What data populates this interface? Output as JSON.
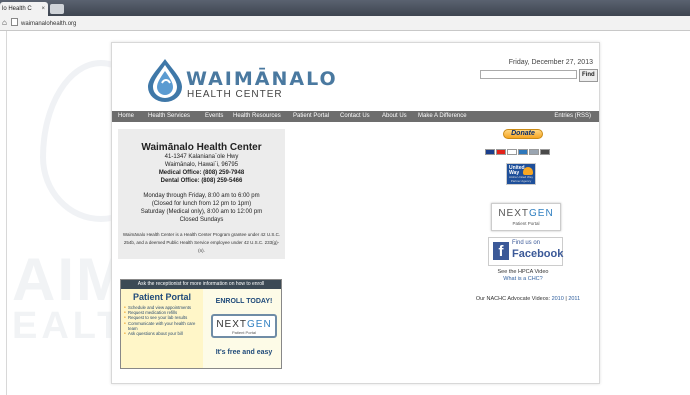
{
  "browser": {
    "tab_title": "lo Health C",
    "tab_close": "×",
    "url": "waimanalohealth.org"
  },
  "watermark": {
    "word1": "AIM",
    "word2": "EALTH"
  },
  "header": {
    "logo_name": "WAIMĀNALO",
    "logo_sub": "HEALTH CENTER",
    "date": "Friday, December 27, 2013",
    "search_placeholder": "",
    "find_label": "Find"
  },
  "nav": {
    "items": [
      "Home",
      "Health Services",
      "Events",
      "Health Resources",
      "Patient Portal",
      "Contact Us",
      "About Us",
      "Make A Difference"
    ],
    "rss": "Entries (RSS)"
  },
  "contact": {
    "title": "Waimānalo Health Center",
    "address1": "41-1347 Kalaniana`ole Hwy",
    "address2": "Waimānalo, Hawai`i, 96795",
    "medical": "Medical Office: (808) 259-7948",
    "dental": "Dental Office: (808) 259-5466",
    "hours1": "Monday through Friday, 8:00 am to 6:00 pm",
    "hours2": "(Closed for lunch from 12 pm to 1pm)",
    "hours3": "Saturday (Medical only), 8:00 am to 12:00 pm",
    "hours4": "Closed Sundays",
    "grantee": "Waimānalo Health Center is a Health Center Program grantee under 42 U.S.C. 254b, and a deemed Public Health Service employee under 42 U.S.C. 233(g)-(n)."
  },
  "portal": {
    "header": "Ask the receptionist for more information on how to enroll",
    "title": "Patient Portal",
    "bullets": [
      "Schedule and view appointments",
      "Request medication refills",
      "Request to see your lab results",
      "Communicate with your health care team",
      "Ask questions about your bill"
    ],
    "enroll": "ENROLL TODAY!",
    "ng_next": "NEXT",
    "ng_gen": "GEN",
    "ng_sub": "Patient Portal",
    "free": "It's free and easy"
  },
  "sidebar": {
    "donate": "Donate",
    "unitedway_line1": "United",
    "unitedway_line2": "Way",
    "unitedway_sub": "Aloha United Way Partner Agency",
    "ng_next": "NEXT",
    "ng_gen": "GEN",
    "ng_sub": "Patient Portal",
    "fb_find": "Find us on",
    "fb_name": "Facebook",
    "fb_letter": "f",
    "hpca": "See the HPCA Video",
    "chc": "What is a CHC?",
    "nachc_prefix": "Our NACHC Advocate Videos: ",
    "nachc_2010": "2010",
    "nachc_sep": " | ",
    "nachc_2011": "2011"
  },
  "colors": {
    "nav_bg": "#6d6d6d",
    "brand_blue": "#4a79a0",
    "facebook_blue": "#3b5998",
    "donate_orange": "#f6a623"
  }
}
